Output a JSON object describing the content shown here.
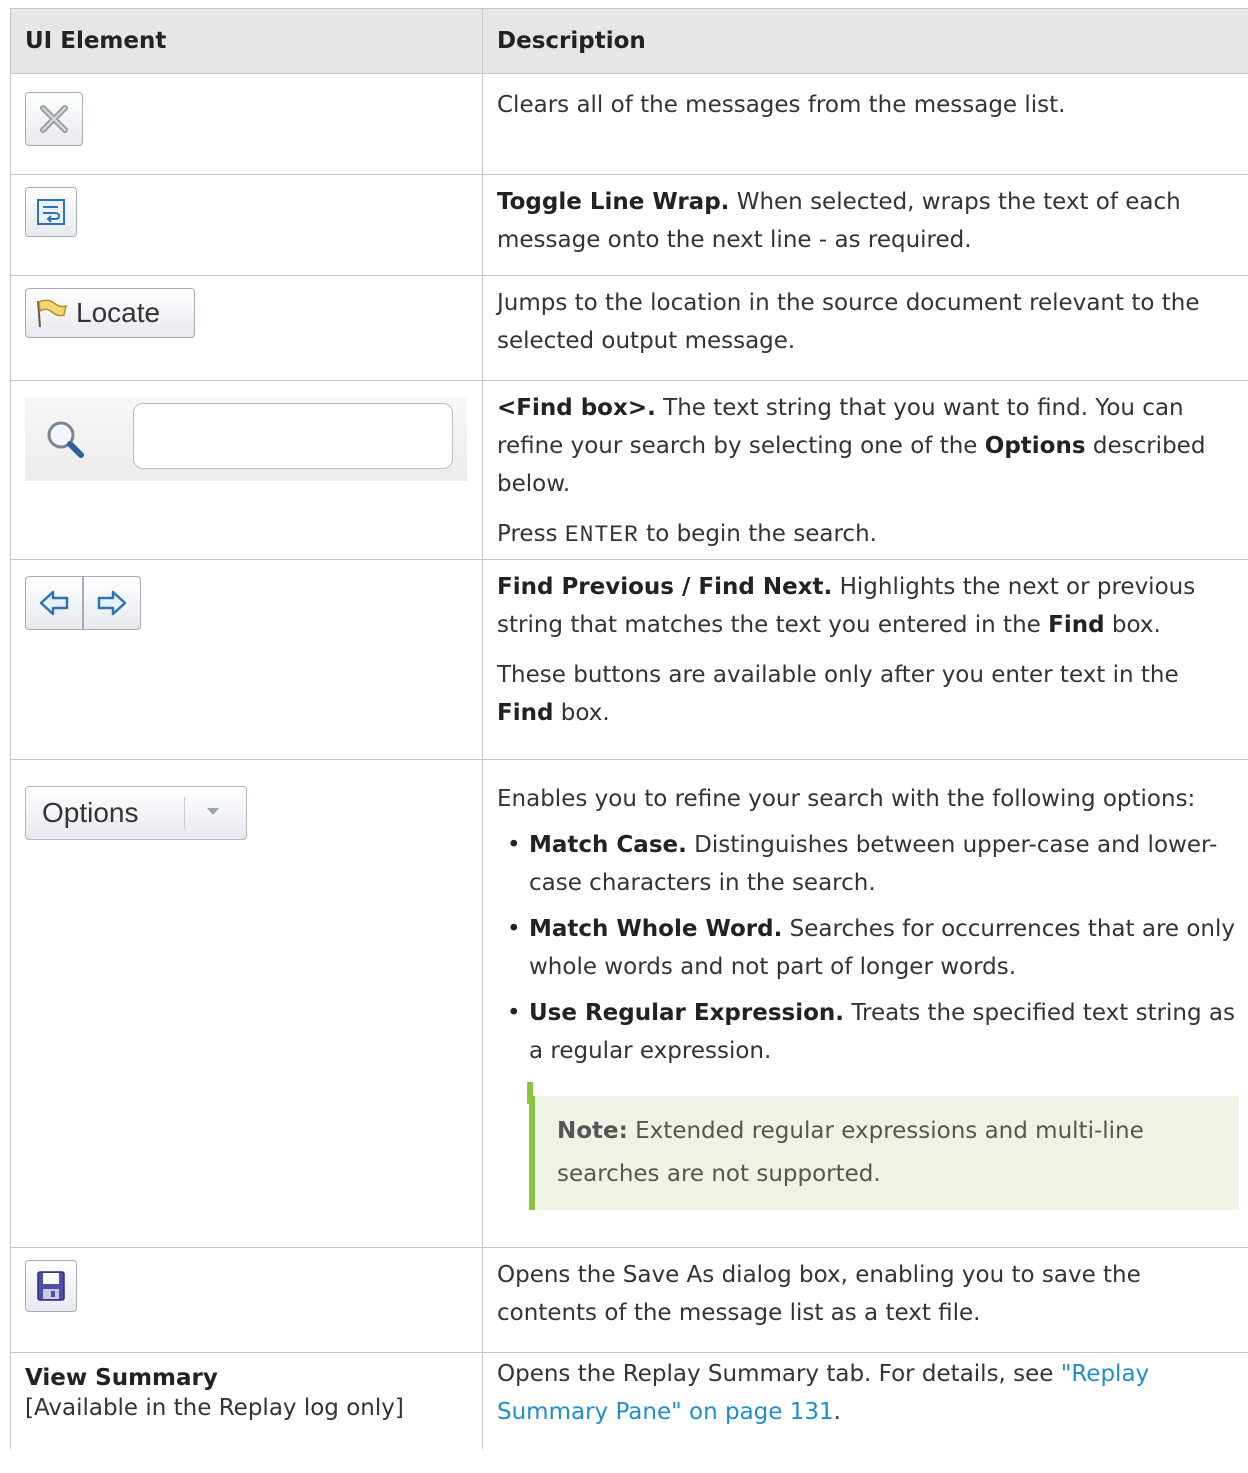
{
  "headers": {
    "col1": "UI Element",
    "col2": "Description"
  },
  "rows": {
    "clear": {
      "desc": "Clears all of the messages from the message list."
    },
    "wrap": {
      "bold": "Toggle Line Wrap.",
      "desc": " When selected, wraps the text of each message onto the next line - as required."
    },
    "locate": {
      "button_label": "Locate",
      "desc": "Jumps to the location in the source document relevant to the selected output message."
    },
    "find": {
      "bold": "<Find box>.",
      "desc_a": " The text string that you want to find. You can refine your search by selecting one of the ",
      "bold_options": "Options",
      "desc_b": " described below.",
      "press": "Press ",
      "key": "ENTER",
      "press_end": " to begin the search.",
      "input_value": ""
    },
    "prevnext": {
      "bold": "Find Previous / Find Next.",
      "desc_a": " Highlights the next or previous string that matches the text you entered in the ",
      "bold_find": "Find",
      "desc_b": " box.",
      "desc2_a": "These buttons are available only after you enter text in the ",
      "bold_find2": "Find",
      "desc2_b": " box."
    },
    "options": {
      "button_label": "Options",
      "intro": "Enables you to refine your search with the following options:",
      "items": [
        {
          "bold": "Match Case.",
          "text": " Distinguishes between upper-case and lower-case characters in the search."
        },
        {
          "bold": "Match Whole Word.",
          "text": " Searches for occurrences that are only whole words and not part of longer words."
        },
        {
          "bold": "Use Regular Expression.",
          "text": " Treats the specified text string as a regular expression."
        }
      ],
      "note_label": "Note:",
      "note_text": " Extended regular expressions and multi-line searches are not supported."
    },
    "save": {
      "desc": "Opens the Save As dialog box, enabling you to save the contents of the message list as a text file."
    },
    "summary": {
      "element_bold": "View Summary",
      "element_sub": "[Available in the Replay log only]",
      "desc": "Opens the Replay Summary tab. For details, see ",
      "link": "\"Replay Summary Pane\" on page 131",
      "desc_end": "."
    }
  },
  "colors": {
    "link": "#1e8ed4",
    "note_bar": "#8cc63f",
    "note_bg": "#eef3e6",
    "header_bg": "#e6e6e6"
  }
}
